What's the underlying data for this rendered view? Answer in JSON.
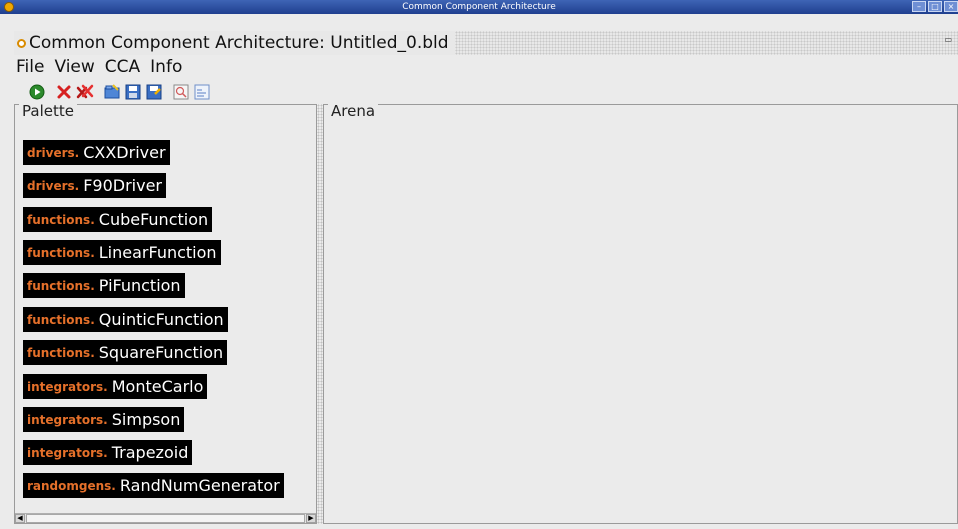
{
  "window": {
    "title": "Common Component Architecture"
  },
  "frame": {
    "title": "Common Component Architecture: Untitled_0.bld"
  },
  "menu": {
    "items": [
      "File",
      "View",
      "CCA",
      "Info"
    ]
  },
  "toolbar": {
    "buttons": [
      {
        "name": "run",
        "icon": "run-icon"
      },
      {
        "name": "delete",
        "icon": "delete-icon"
      },
      {
        "name": "delete-all",
        "icon": "delete-all-icon"
      },
      {
        "name": "open",
        "icon": "open-folder-icon"
      },
      {
        "name": "save",
        "icon": "save-icon"
      },
      {
        "name": "save-as",
        "icon": "save-as-icon"
      },
      {
        "name": "zoom",
        "icon": "zoom-icon"
      },
      {
        "name": "console",
        "icon": "console-icon"
      }
    ]
  },
  "palette": {
    "title": "Palette",
    "items": [
      {
        "package": "drivers.",
        "component": "CXXDriver"
      },
      {
        "package": "drivers.",
        "component": "F90Driver"
      },
      {
        "package": "functions.",
        "component": "CubeFunction"
      },
      {
        "package": "functions.",
        "component": "LinearFunction"
      },
      {
        "package": "functions.",
        "component": "PiFunction"
      },
      {
        "package": "functions.",
        "component": "QuinticFunction"
      },
      {
        "package": "functions.",
        "component": "SquareFunction"
      },
      {
        "package": "integrators.",
        "component": "MonteCarlo"
      },
      {
        "package": "integrators.",
        "component": "Simpson"
      },
      {
        "package": "integrators.",
        "component": "Trapezoid"
      },
      {
        "package": "randomgens.",
        "component": "RandNumGenerator"
      }
    ]
  },
  "arena": {
    "title": "Arena"
  },
  "colors": {
    "package_text": "#e5702a",
    "item_bg": "#000000",
    "component_text": "#ffffff"
  }
}
